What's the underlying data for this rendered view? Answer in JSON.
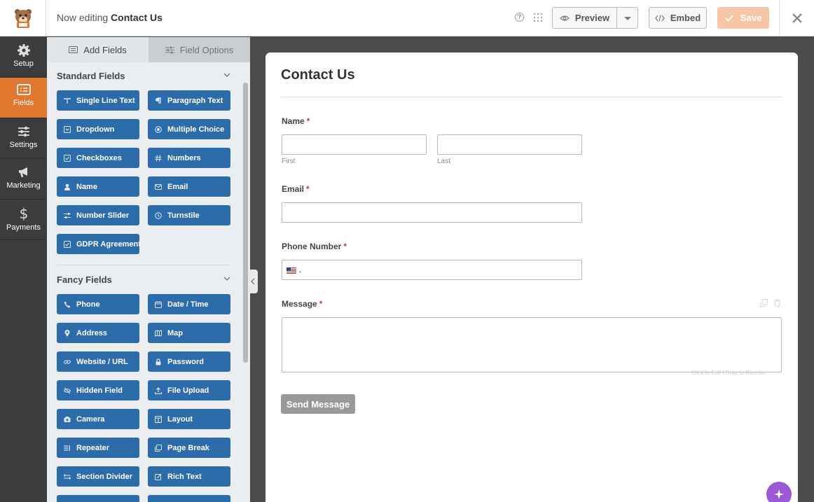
{
  "header": {
    "title_prefix": "Now editing",
    "form_name": "Contact Us",
    "preview_label": "Preview",
    "embed_label": "Embed",
    "save_label": "Save"
  },
  "nav": [
    {
      "label": "Setup",
      "icon": "gear-icon"
    },
    {
      "label": "Fields",
      "icon": "fields-list-icon",
      "active": true
    },
    {
      "label": "Settings",
      "icon": "sliders-icon"
    },
    {
      "label": "Marketing",
      "icon": "megaphone-icon"
    },
    {
      "label": "Payments",
      "icon": "dollar-icon"
    }
  ],
  "panel": {
    "tabs": [
      {
        "label": "Add Fields",
        "icon": "add-fields-icon",
        "active": true
      },
      {
        "label": "Field Options",
        "icon": "field-options-icon"
      }
    ],
    "groups": [
      {
        "title": "Standard Fields",
        "fields": [
          {
            "label": "Single Line Text",
            "icon": "single-line-text-icon"
          },
          {
            "label": "Paragraph Text",
            "icon": "paragraph-icon"
          },
          {
            "label": "Dropdown",
            "icon": "dropdown-icon"
          },
          {
            "label": "Multiple Choice",
            "icon": "radio-icon"
          },
          {
            "label": "Checkboxes",
            "icon": "checkbox-icon"
          },
          {
            "label": "Numbers",
            "icon": "hash-icon"
          },
          {
            "label": "Name",
            "icon": "user-icon"
          },
          {
            "label": "Email",
            "icon": "envelope-icon"
          },
          {
            "label": "Number Slider",
            "icon": "slider-icon"
          },
          {
            "label": "Turnstile",
            "icon": "turnstile-icon"
          },
          {
            "label": "GDPR Agreement",
            "icon": "checkbox-icon"
          }
        ]
      },
      {
        "title": "Fancy Fields",
        "fields": [
          {
            "label": "Phone",
            "icon": "phone-icon"
          },
          {
            "label": "Date / Time",
            "icon": "calendar-icon"
          },
          {
            "label": "Address",
            "icon": "map-pin-icon"
          },
          {
            "label": "Map",
            "icon": "map-icon"
          },
          {
            "label": "Website / URL",
            "icon": "link-icon"
          },
          {
            "label": "Password",
            "icon": "lock-icon"
          },
          {
            "label": "Hidden Field",
            "icon": "eye-slash-icon"
          },
          {
            "label": "File Upload",
            "icon": "upload-icon"
          },
          {
            "label": "Camera",
            "icon": "camera-icon"
          },
          {
            "label": "Layout",
            "icon": "layout-icon"
          },
          {
            "label": "Repeater",
            "icon": "repeater-icon"
          },
          {
            "label": "Page Break",
            "icon": "page-break-icon"
          },
          {
            "label": "Section Divider",
            "icon": "divider-icon"
          },
          {
            "label": "Rich Text",
            "icon": "rich-text-icon"
          }
        ]
      }
    ]
  },
  "form": {
    "title": "Contact Us",
    "fields": {
      "name": {
        "label": "Name",
        "required": "*",
        "first": "First",
        "last": "Last"
      },
      "email": {
        "label": "Email",
        "required": "*"
      },
      "phone": {
        "label": "Phone Number",
        "required": "*",
        "flag": "us-flag-icon",
        "dial": "•"
      },
      "message": {
        "label": "Message",
        "required": "*"
      }
    },
    "field_hint": "Click to Edit | Drag to Reorder",
    "submit_label": "Send Message"
  },
  "colors": {
    "accent": "#e27730",
    "field_button": "#2d6caa",
    "save_disabled": "#f7c6a6",
    "nav_bg": "#3c3c3c",
    "required": "#d63638",
    "fab": "#9b59d6"
  }
}
